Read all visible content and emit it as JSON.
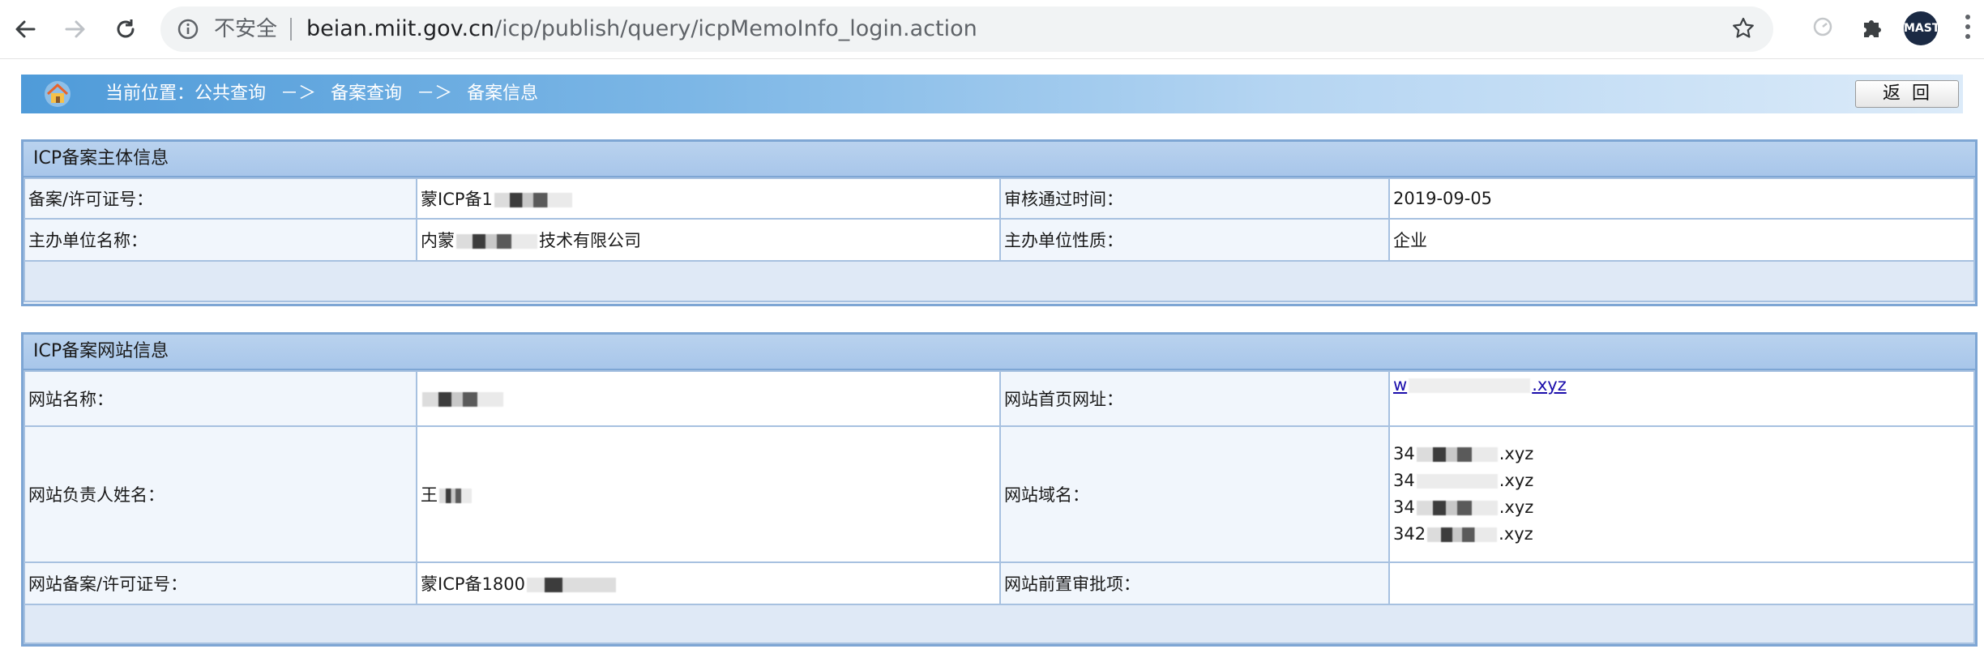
{
  "browser": {
    "security_label": "不安全",
    "url_host": "beian.miit.gov.cn",
    "url_path": "/icp/publish/query/icpMemoInfo_login.action",
    "avatar_text": "MASTER"
  },
  "breadcrumb": {
    "prefix": "当前位置：",
    "items": [
      "公共查询",
      "备案查询",
      "备案信息"
    ],
    "separator": "－＞"
  },
  "back_button_label": "返回",
  "subject_panel": {
    "title": "ICP备案主体信息",
    "license_label": "备案/许可证号：",
    "license_value": "蒙ICP备1",
    "approve_time_label": "审核通过时间：",
    "approve_time_value": "2019-09-05",
    "org_name_label": "主办单位名称：",
    "org_name_prefix": "内蒙",
    "org_name_suffix": "技术有限公司",
    "org_type_label": "主办单位性质：",
    "org_type_value": "企业"
  },
  "website_panel": {
    "title": "ICP备案网站信息",
    "site_name_label": "网站名称：",
    "homepage_label": "网站首页网址：",
    "homepage_prefix": "w",
    "homepage_suffix": ".xyz",
    "owner_label": "网站负责人姓名：",
    "owner_prefix": "王",
    "domain_label": "网站域名：",
    "domains": [
      {
        "prefix": "34",
        "suffix": ".xyz"
      },
      {
        "prefix": "34",
        "suffix": ".xyz"
      },
      {
        "prefix": "34",
        "suffix": ".xyz"
      },
      {
        "prefix": "342",
        "suffix": ".xyz"
      }
    ],
    "site_license_label": "网站备案/许可证号：",
    "site_license_value": "蒙ICP备1800",
    "pre_approval_label": "网站前置审批项：",
    "pre_approval_value": ""
  }
}
